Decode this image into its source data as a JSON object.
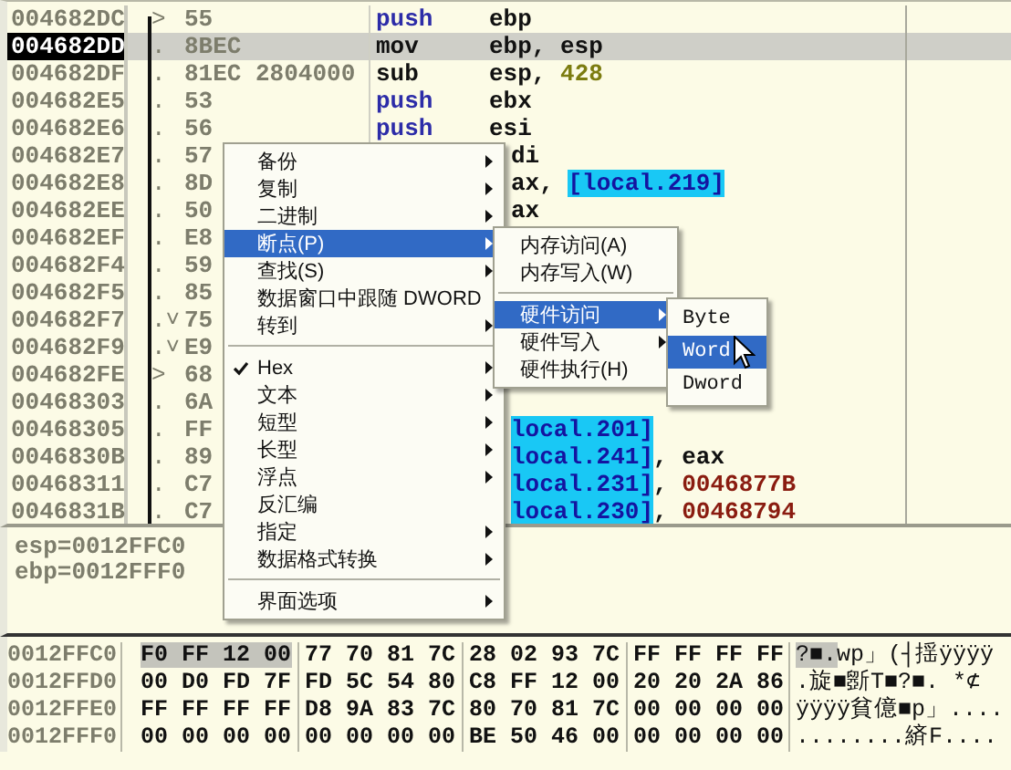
{
  "disassembly": {
    "rows": [
      {
        "address": "004682DC",
        "mark": ">",
        "hex": "55",
        "mnemonic": {
          "text": "push",
          "kind": "stack"
        },
        "operand": [
          {
            "text": "ebp",
            "kind": "plain"
          }
        ],
        "kind": "full",
        "selected": false
      },
      {
        "address": "004682DD",
        "mark": ".",
        "hex": "8BEC",
        "mnemonic": {
          "text": "mov",
          "kind": "plain"
        },
        "operand": [
          {
            "text": "ebp, esp",
            "kind": "plain"
          }
        ],
        "kind": "full",
        "selected": true
      },
      {
        "address": "004682DF",
        "mark": ".",
        "hex": "81EC 2804000",
        "mnemonic": {
          "text": "sub",
          "kind": "plain"
        },
        "operand": [
          {
            "text": "esp, ",
            "kind": "plain"
          },
          {
            "text": "428",
            "kind": "const"
          }
        ],
        "kind": "full",
        "selected": false
      },
      {
        "address": "004682E5",
        "mark": ".",
        "hex": "53",
        "mnemonic": {
          "text": "push",
          "kind": "stack"
        },
        "operand": [
          {
            "text": "ebx",
            "kind": "plain"
          }
        ],
        "kind": "full",
        "selected": false
      },
      {
        "address": "004682E6",
        "mark": ".",
        "hex": "56",
        "mnemonic": {
          "text": "push",
          "kind": "stack"
        },
        "operand": [
          {
            "text": "esi",
            "kind": "plain"
          }
        ],
        "kind": "full",
        "selected": false
      },
      {
        "address": "004682E7",
        "mark": ".",
        "hex": "57",
        "operand": [
          {
            "text": "di",
            "kind": "plain"
          }
        ],
        "kind": "under_menu",
        "selected": false
      },
      {
        "address": "004682E8",
        "mark": ".",
        "hex": "8D",
        "operand": [
          {
            "text": "ax, ",
            "kind": "plain"
          },
          {
            "text": "[local.219]",
            "kind": "local"
          }
        ],
        "kind": "under_menu",
        "selected": false
      },
      {
        "address": "004682EE",
        "mark": ".",
        "hex": "50",
        "operand": [
          {
            "text": "ax",
            "kind": "plain"
          }
        ],
        "kind": "under_menu",
        "selected": false
      },
      {
        "address": "004682EF",
        "mark": ".",
        "hex": "E8",
        "kind": "under_menu",
        "selected": false
      },
      {
        "address": "004682F4",
        "mark": ".",
        "hex": "59",
        "kind": "under_menu",
        "selected": false
      },
      {
        "address": "004682F5",
        "mark": ".",
        "hex": "85",
        "kind": "under_menu",
        "selected": false
      },
      {
        "address": "004682F7",
        "mark": ".˅",
        "hex": "75",
        "kind": "under_menu",
        "selected": false
      },
      {
        "address": "004682F9",
        "mark": ".˅",
        "hex": "E9",
        "kind": "under_menu",
        "selected": false
      },
      {
        "address": "004682FE",
        "mark": ">",
        "hex": "68",
        "kind": "under_menu",
        "selected": false
      },
      {
        "address": "00468303",
        "mark": ".",
        "hex": "6A",
        "kind": "under_menu",
        "selected": false
      },
      {
        "address": "00468305",
        "mark": ".",
        "hex": "FF",
        "operand": [
          {
            "text": "local.201]",
            "kind": "local"
          }
        ],
        "kind": "under_menu",
        "selected": false
      },
      {
        "address": "0046830B",
        "mark": ".",
        "hex": "89",
        "operand": [
          {
            "text": "local.241]",
            "kind": "local"
          },
          {
            "text": ", eax",
            "kind": "plain"
          }
        ],
        "kind": "under_menu",
        "selected": false
      },
      {
        "address": "00468311",
        "mark": ".",
        "hex": "C7",
        "operand": [
          {
            "text": "local.231]",
            "kind": "local"
          },
          {
            "text": ", ",
            "kind": "plain"
          },
          {
            "text": "0046877B",
            "kind": "addr"
          }
        ],
        "kind": "under_menu",
        "selected": false
      },
      {
        "address": "0046831B",
        "mark": ".",
        "hex": "C7",
        "operand": [
          {
            "text": "local.230]",
            "kind": "local"
          },
          {
            "text": ", ",
            "kind": "plain"
          },
          {
            "text": "00468794",
            "kind": "addr"
          }
        ],
        "kind": "under_menu",
        "selected": false
      }
    ]
  },
  "registers": [
    "esp=0012FFC0",
    "ebp=0012FFF0"
  ],
  "dump": {
    "rows": [
      {
        "address": "0012FFC0",
        "groups": [
          {
            "text": "F0 FF 12 00",
            "selected": true
          },
          {
            "text": "77 70 81 7C",
            "selected": false
          },
          {
            "text": "28 02 93 7C",
            "selected": false
          },
          {
            "text": "FF FF FF FF",
            "selected": false
          }
        ],
        "ascii": [
          {
            "text": "?■.",
            "selected": true
          },
          {
            "text": "wp」(┤揺ÿÿÿÿ",
            "selected": false
          }
        ]
      },
      {
        "address": "0012FFD0",
        "groups": [
          {
            "text": "00 D0 FD 7F",
            "selected": false
          },
          {
            "text": "FD 5C 54 80",
            "selected": false
          },
          {
            "text": "C8 FF 12 00",
            "selected": false
          },
          {
            "text": "20 20 2A 86",
            "selected": false
          }
        ],
        "ascii": [
          {
            "text": ".旋■斵T■?■.  *⊄",
            "selected": false
          }
        ]
      },
      {
        "address": "0012FFE0",
        "groups": [
          {
            "text": "FF FF FF FF",
            "selected": false
          },
          {
            "text": "D8 9A 83 7C",
            "selected": false
          },
          {
            "text": "80 70 81 7C",
            "selected": false
          },
          {
            "text": "00 00 00 00",
            "selected": false
          }
        ],
        "ascii": [
          {
            "text": "ÿÿÿÿ貧億■p」....",
            "selected": false
          }
        ]
      },
      {
        "address": "0012FFF0",
        "groups": [
          {
            "text": "00 00 00 00",
            "selected": false
          },
          {
            "text": "00 00 00 00",
            "selected": false
          },
          {
            "text": "BE 50 46 00",
            "selected": false
          },
          {
            "text": "00 00 00 00",
            "selected": false
          }
        ],
        "ascii": [
          {
            "text": "........緕F....",
            "selected": false
          }
        ]
      }
    ]
  },
  "context_menu": {
    "items": [
      {
        "kind": "item",
        "label": "备份",
        "submenu": true,
        "selected": false,
        "checked": false
      },
      {
        "kind": "item",
        "label": "复制",
        "submenu": true,
        "selected": false,
        "checked": false
      },
      {
        "kind": "item",
        "label": "二进制",
        "submenu": true,
        "selected": false,
        "checked": false
      },
      {
        "kind": "item",
        "label": "断点(P)",
        "submenu": true,
        "selected": true,
        "checked": false
      },
      {
        "kind": "item",
        "label": "查找(S)",
        "submenu": true,
        "selected": false,
        "checked": false
      },
      {
        "kind": "item",
        "label": "数据窗口中跟随 DWORD",
        "submenu": false,
        "selected": false,
        "checked": false
      },
      {
        "kind": "item",
        "label": "转到",
        "submenu": true,
        "selected": false,
        "checked": false
      },
      {
        "kind": "separator"
      },
      {
        "kind": "item",
        "label": "Hex",
        "submenu": true,
        "selected": false,
        "checked": true
      },
      {
        "kind": "item",
        "label": "文本",
        "submenu": true,
        "selected": false,
        "checked": false
      },
      {
        "kind": "item",
        "label": "短型",
        "submenu": true,
        "selected": false,
        "checked": false
      },
      {
        "kind": "item",
        "label": "长型",
        "submenu": true,
        "selected": false,
        "checked": false
      },
      {
        "kind": "item",
        "label": "浮点",
        "submenu": true,
        "selected": false,
        "checked": false
      },
      {
        "kind": "item",
        "label": "反汇编",
        "submenu": false,
        "selected": false,
        "checked": false
      },
      {
        "kind": "item",
        "label": "指定",
        "submenu": true,
        "selected": false,
        "checked": false
      },
      {
        "kind": "item",
        "label": "数据格式转换",
        "submenu": true,
        "selected": false,
        "checked": false
      },
      {
        "kind": "separator"
      },
      {
        "kind": "item",
        "label": "界面选项",
        "submenu": true,
        "selected": false,
        "checked": false
      }
    ]
  },
  "breakpoint_menu": {
    "items": [
      {
        "kind": "item",
        "label": "内存访问(A)",
        "submenu": false,
        "selected": false
      },
      {
        "kind": "item",
        "label": "内存写入(W)",
        "submenu": false,
        "selected": false
      },
      {
        "kind": "separator"
      },
      {
        "kind": "item",
        "label": "硬件访问",
        "submenu": true,
        "selected": true
      },
      {
        "kind": "item",
        "label": "硬件写入",
        "submenu": true,
        "selected": false
      },
      {
        "kind": "item",
        "label": "硬件执行(H)",
        "submenu": false,
        "selected": false
      }
    ]
  },
  "hardware_menu": {
    "items": [
      {
        "kind": "item",
        "label": "Byte",
        "selected": false
      },
      {
        "kind": "item",
        "label": "Word",
        "selected": true
      },
      {
        "kind": "item",
        "label": "Dword",
        "selected": false
      }
    ]
  }
}
